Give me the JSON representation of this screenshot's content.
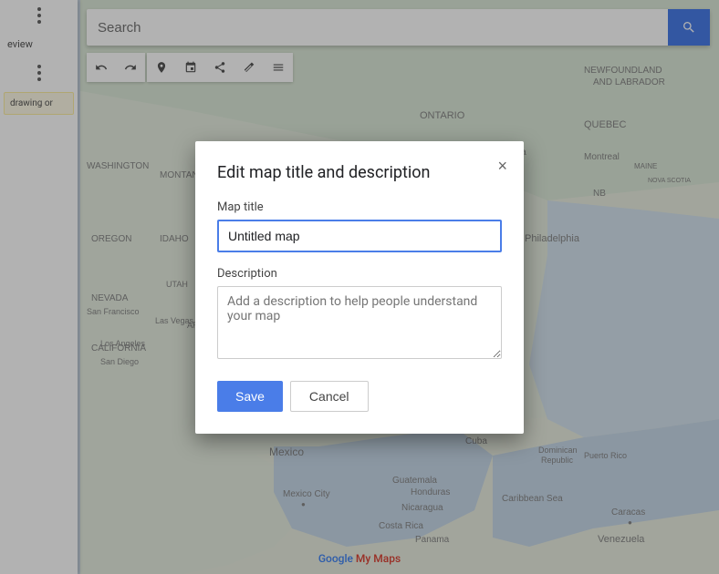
{
  "map": {
    "footer_google": "Google ",
    "footer_mymaps": "My Maps"
  },
  "toolbar": {
    "search_placeholder": "Search"
  },
  "sidebar": {
    "menu_dots": "⋮",
    "preview_label": "eview",
    "drawing_label": "drawing or"
  },
  "tools": {
    "undo_icon": "↩",
    "redo_icon": "↪",
    "pin_icon": "📍",
    "marker_icon": "📌",
    "share_icon": "↗",
    "ruler_icon": "📏",
    "lines_icon": "≡"
  },
  "dialog": {
    "title": "Edit map title and description",
    "close_label": "×",
    "map_title_label": "Map title",
    "map_title_value": "Untitled map",
    "description_label": "Description",
    "description_placeholder": "Add a description to help people understand your map",
    "save_label": "Save",
    "cancel_label": "Cancel"
  }
}
